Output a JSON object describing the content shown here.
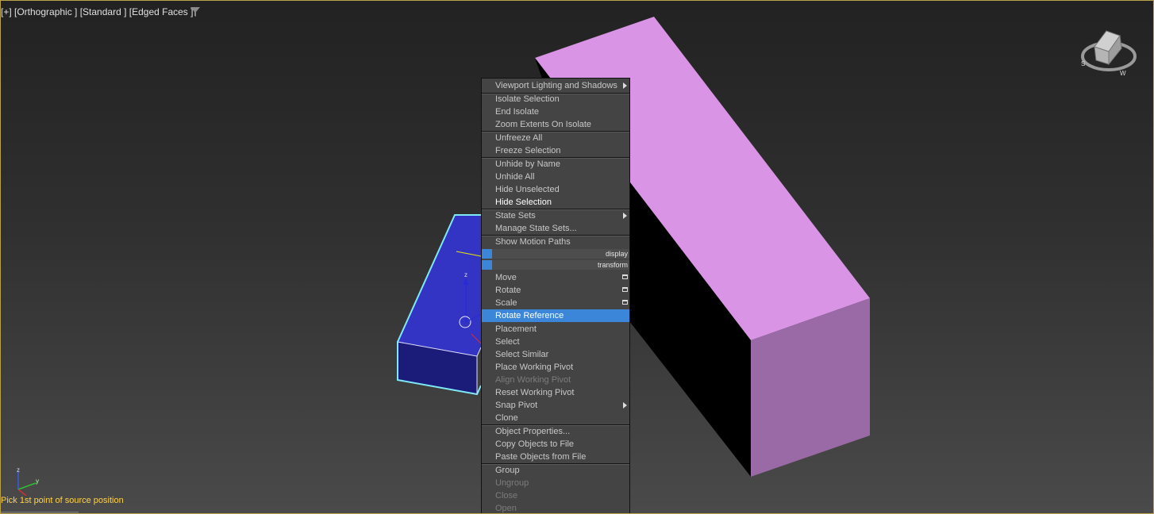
{
  "viewport": {
    "label": "[+] [Orthographic ] [Standard ] [Edged Faces ]",
    "status_prompt": "Pick 1st point of source position"
  },
  "colors": {
    "selected_box": "#3434c4",
    "selection_outline": "#7fe8f5",
    "pink_box_top": "#d994e5",
    "pink_box_side": "#9a6aa6",
    "menu_highlight": "#3b86d8"
  },
  "icons": {
    "filter": "funnel-icon",
    "submenu": "triangle-right-icon",
    "options": "window-options-icon"
  },
  "quad_menu": {
    "display_header": "display",
    "transform_header": "transform",
    "display": [
      {
        "label": "Viewport Lighting and Shadows",
        "submenu": true
      },
      {
        "label": "Isolate Selection"
      },
      {
        "label": "End Isolate"
      },
      {
        "label": "Zoom Extents On Isolate"
      },
      {
        "label": "Unfreeze All"
      },
      {
        "label": "Freeze Selection"
      },
      {
        "label": "Unhide by Name"
      },
      {
        "label": "Unhide All"
      },
      {
        "label": "Hide Unselected"
      },
      {
        "label": "Hide Selection"
      },
      {
        "label": "State Sets",
        "submenu": true
      },
      {
        "label": "Manage State Sets..."
      },
      {
        "label": "Show Motion Paths"
      }
    ],
    "transform": [
      {
        "label": "Move"
      },
      {
        "label": "Rotate"
      },
      {
        "label": "Scale"
      },
      {
        "label": "Rotate Reference"
      },
      {
        "label": "Placement"
      },
      {
        "label": "Select"
      },
      {
        "label": "Select Similar"
      },
      {
        "label": "Place Working Pivot"
      },
      {
        "label": "Align Working Pivot"
      },
      {
        "label": "Reset Working Pivot"
      },
      {
        "label": "Snap Pivot",
        "submenu": true
      },
      {
        "label": "Clone"
      },
      {
        "label": "Object Properties..."
      },
      {
        "label": "Copy Objects to File"
      },
      {
        "label": "Paste Objects from File"
      },
      {
        "label": "Group"
      },
      {
        "label": "Ungroup"
      },
      {
        "label": "Close"
      },
      {
        "label": "Open"
      }
    ]
  }
}
